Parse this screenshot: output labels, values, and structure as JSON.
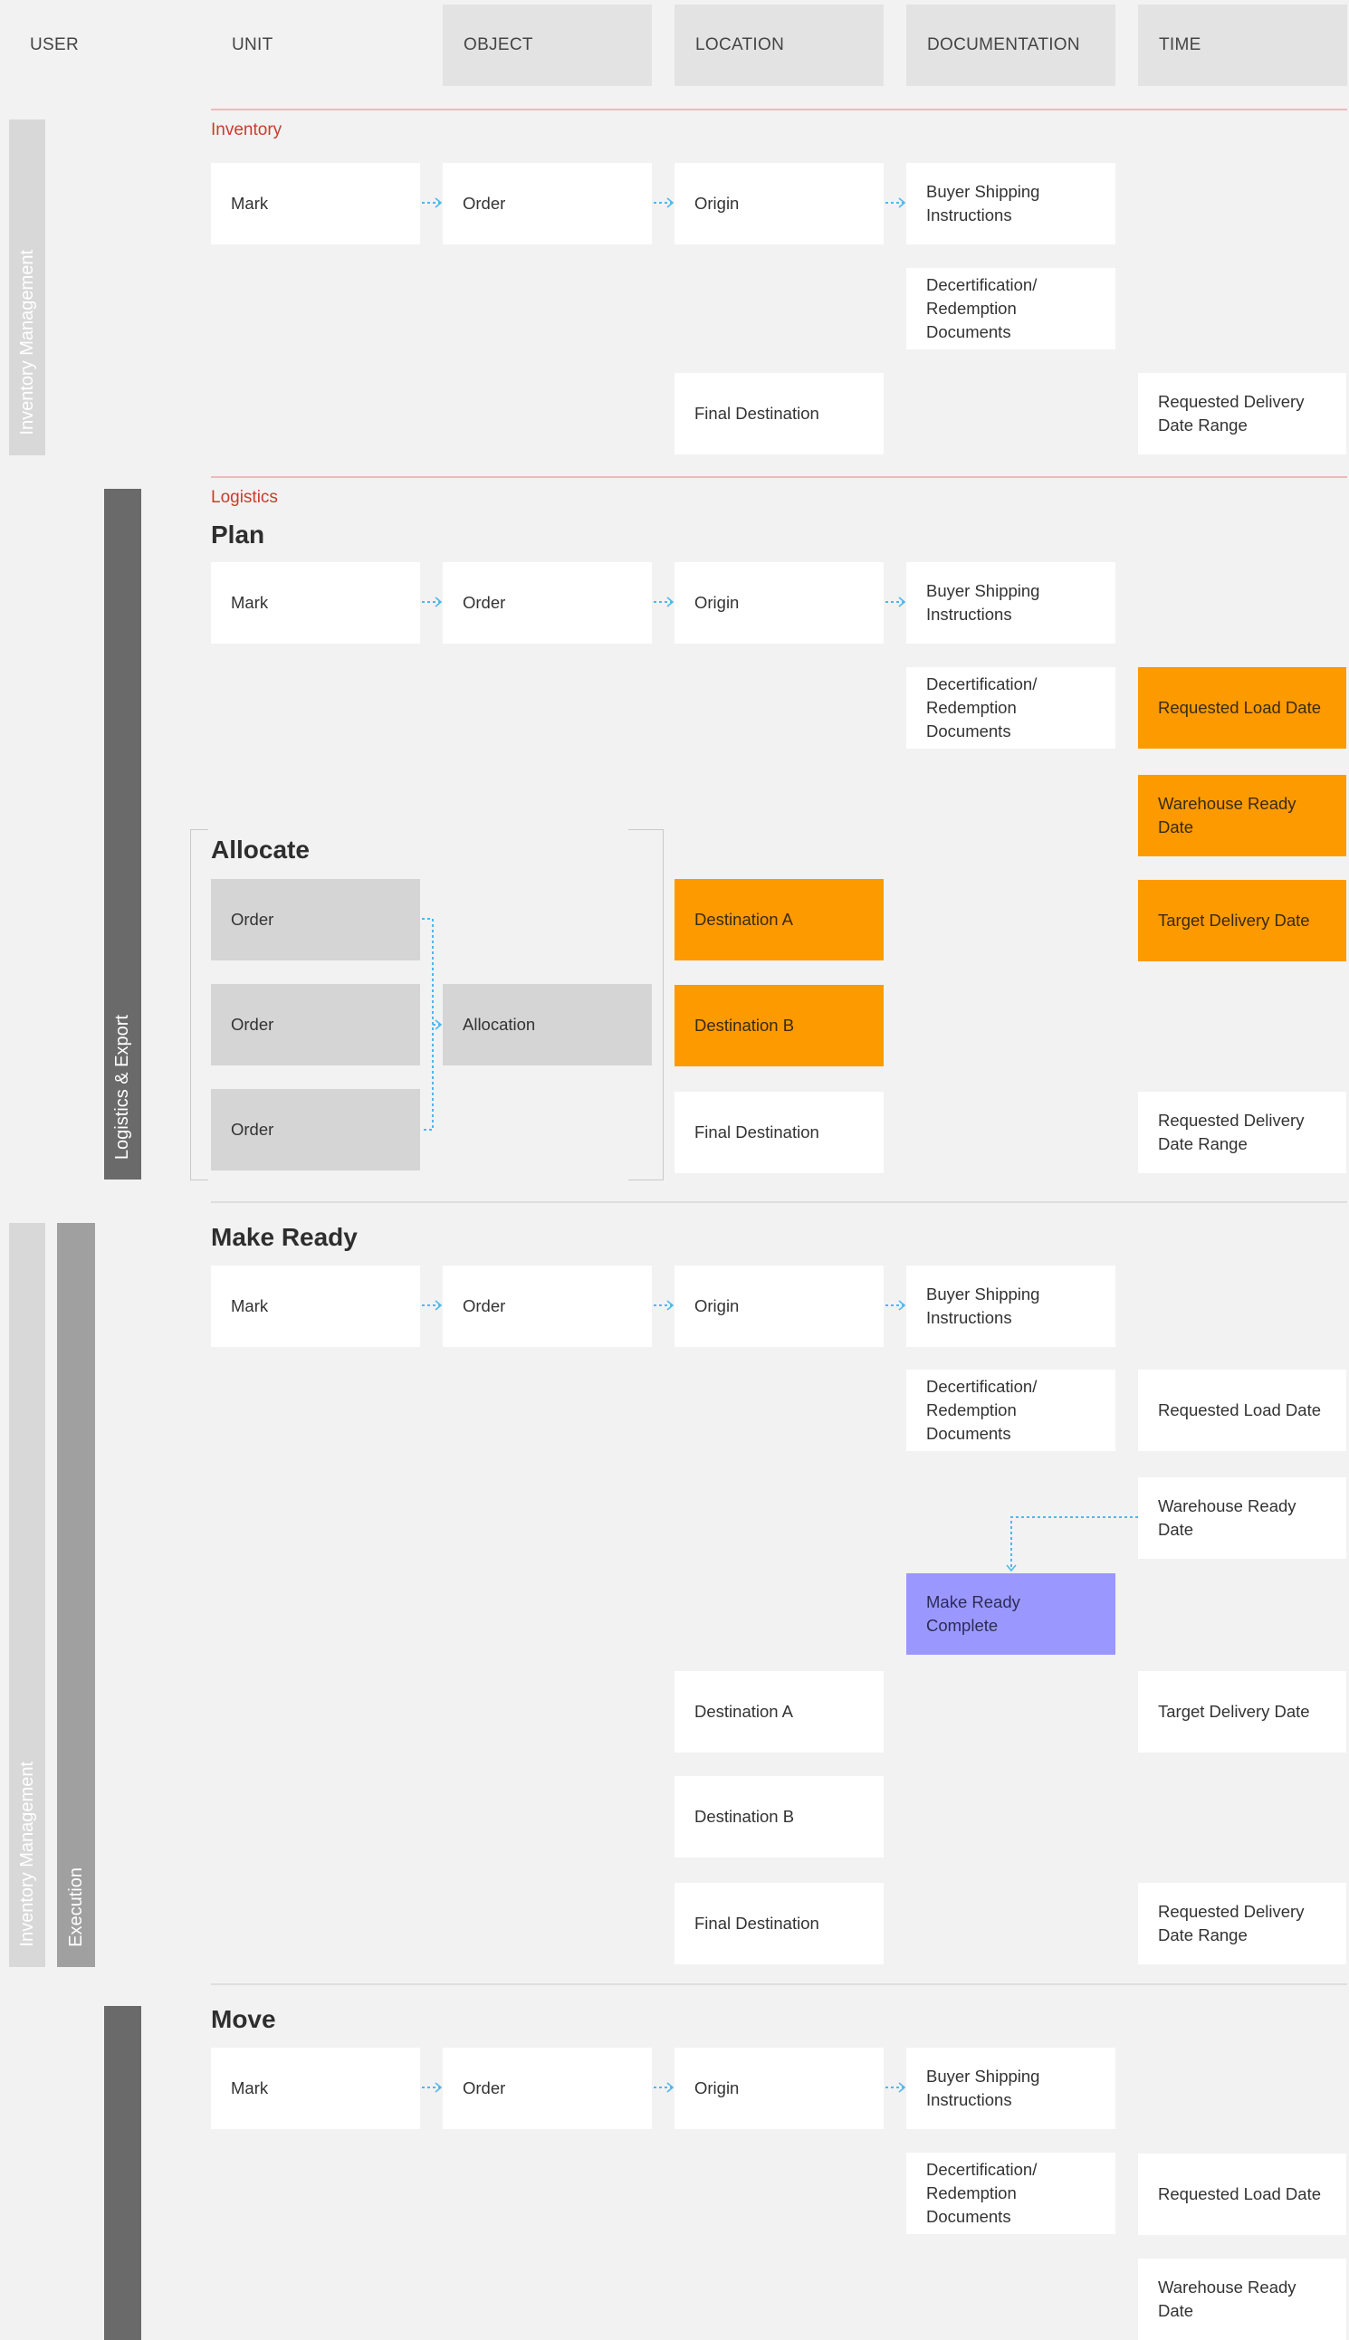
{
  "columns": {
    "user": "USER",
    "unit": "UNIT",
    "object": "OBJECT",
    "location": "LOCATION",
    "documentation": "DOCUMENTATION",
    "time": "TIME"
  },
  "side_bars": {
    "inventory_management_1": "Inventory Management",
    "logistics_export": "Logistics & Export",
    "inventory_management_2": "Inventory Management",
    "execution": "Execution"
  },
  "inventory": {
    "label": "Inventory",
    "mark": "Mark",
    "order": "Order",
    "origin": "Origin",
    "buyer_shipping": "Buyer Shipping Instructions",
    "decert": "Decertification/ Redemption Documents",
    "final_destination": "Final Destination",
    "requested_delivery": "Requested Delivery Date Range"
  },
  "logistics": {
    "label": "Logistics",
    "plan": {
      "title": "Plan",
      "mark": "Mark",
      "order": "Order",
      "origin": "Origin",
      "buyer_shipping": "Buyer Shipping Instructions",
      "decert": "Decertification/ Redemption Documents",
      "requested_load": "Requested Load Date",
      "warehouse_ready": "Warehouse Ready Date"
    },
    "allocate": {
      "title": "Allocate",
      "orders": [
        "Order",
        "Order",
        "Order"
      ],
      "allocation": "Allocation",
      "destination_a": "Destination A",
      "destination_b": "Destination B",
      "final_destination": "Final Destination",
      "target_delivery": "Target Delivery Date",
      "requested_delivery": "Requested Delivery Date Range"
    }
  },
  "make_ready": {
    "title": "Make Ready",
    "mark": "Mark",
    "order": "Order",
    "origin": "Origin",
    "buyer_shipping": "Buyer Shipping Instructions",
    "decert": "Decertification/ Redemption Documents",
    "requested_load": "Requested Load Date",
    "warehouse_ready": "Warehouse Ready Date",
    "complete": "Make Ready Complete",
    "destination_a": "Destination A",
    "destination_b": "Destination B",
    "final_destination": "Final Destination",
    "target_delivery": "Target Delivery Date",
    "requested_delivery": "Requested Delivery Date Range"
  },
  "move": {
    "title": "Move",
    "mark": "Mark",
    "order": "Order",
    "origin": "Origin",
    "buyer_shipping": "Buyer Shipping Instructions",
    "decert": "Decertification/ Redemption Documents",
    "requested_load": "Requested Load Date",
    "warehouse_ready": "Warehouse Ready Date"
  },
  "colors": {
    "background": "#f2f2f2",
    "highlight_orange": "#fd9a00",
    "complete_purple": "#9a98ff",
    "connector_blue": "#4db8ee",
    "section_label_red": "#cc3b2e"
  }
}
